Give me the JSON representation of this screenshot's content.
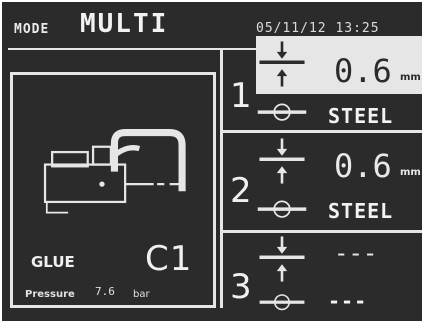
{
  "header": {
    "mode_label": "MODE",
    "mode_value": "MULTI",
    "datetime": "05/11/12 13:25"
  },
  "gun": {
    "glue_label": "GLUE",
    "code": "C1",
    "pressure_label": "Pressure",
    "pressure_value": "7.6",
    "pressure_unit": "bar"
  },
  "layers": [
    {
      "number": "1",
      "thickness": "0.6",
      "unit": "mm",
      "material": "STEEL"
    },
    {
      "number": "2",
      "thickness": "0.6",
      "unit": "mm",
      "material": "STEEL"
    },
    {
      "number": "3",
      "thickness": "---",
      "unit": "",
      "material": "---"
    }
  ],
  "icons": {
    "gun": "spot-welding-gun-icon",
    "thickness": "sheet-thickness-arrows-icon",
    "material": "sheet-material-icon"
  },
  "colors": {
    "screen_bg": "#2b2b2b",
    "foreground": "#e6e6e6",
    "highlight_bg": "#e6e6e6",
    "highlight_fg": "#2b2b2b"
  }
}
